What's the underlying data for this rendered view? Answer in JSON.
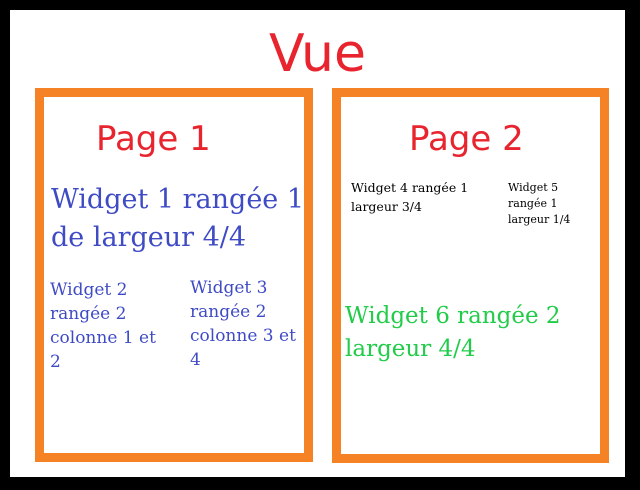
{
  "view": {
    "title": "Vue"
  },
  "pages": [
    {
      "title": "Page 1",
      "widgets": [
        {
          "text": "Widget 1 rangée 1 de largeur 4/4"
        },
        {
          "text": "Widget 2 rangée 2 colonne 1 et 2"
        },
        {
          "text": "Widget 3 rangée 2 colonne 3 et 4"
        }
      ]
    },
    {
      "title": "Page 2",
      "widgets": [
        {
          "text": "Widget 4 rangée 1 largeur 3/4"
        },
        {
          "text": "Widget 5 rangée 1 largeur 1/4"
        },
        {
          "text": "Widget 6 rangée 2 largeur 4/4"
        }
      ]
    }
  ],
  "colors": {
    "title_red": "#e8252e",
    "page_border_orange": "#f58225",
    "blue_text": "#3f4bc4",
    "green_text": "#22cc4a",
    "frame_black": "#000000"
  }
}
